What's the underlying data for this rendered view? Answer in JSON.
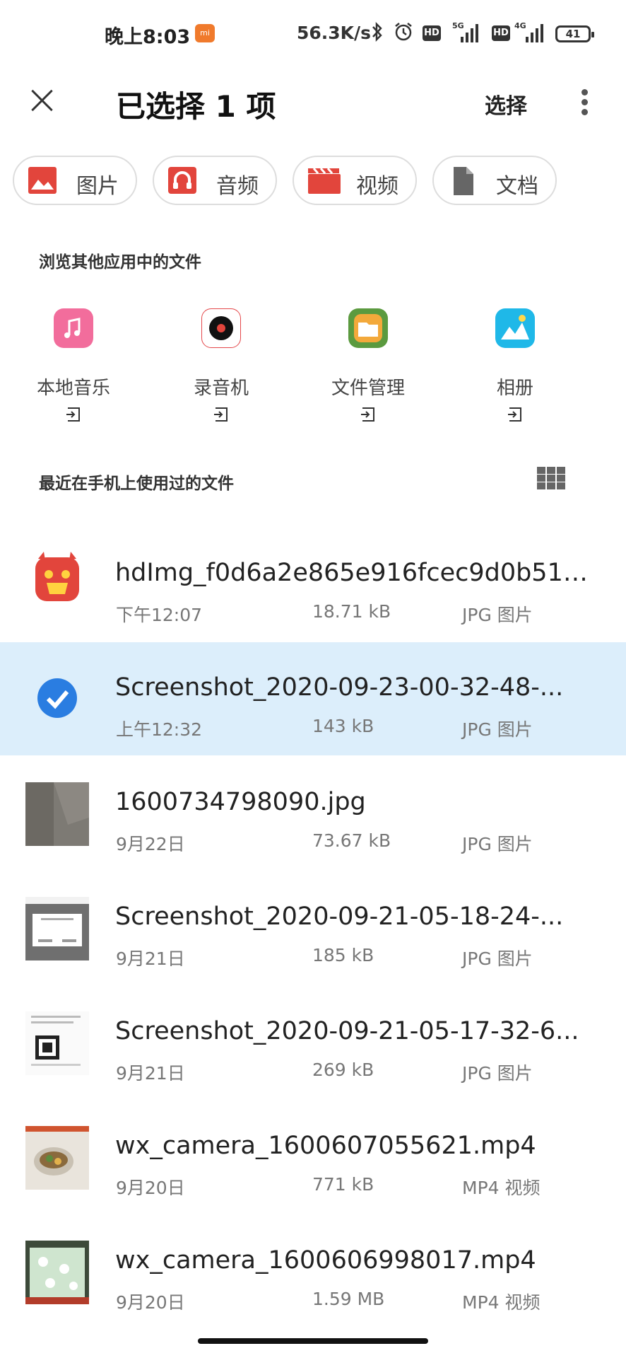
{
  "status_bar": {
    "time": "晚上8:03",
    "mi_badge": "mi",
    "speed": "56.3K/s",
    "signal1_label": "5G",
    "signal2_label": "4G",
    "hd_label": "HD",
    "battery": "41"
  },
  "header": {
    "title": "已选择 1 项",
    "select_label": "选择"
  },
  "categories": [
    {
      "label": "图片",
      "icon": "image-icon",
      "color": "#e2453c"
    },
    {
      "label": "音频",
      "icon": "headphones-icon",
      "color": "#e2453c"
    },
    {
      "label": "视频",
      "icon": "clapperboard-icon",
      "color": "#e2453c"
    },
    {
      "label": "文档",
      "icon": "document-icon",
      "color": "#666666"
    }
  ],
  "browse_section_label": "浏览其他应用中的文件",
  "apps": [
    {
      "label": "本地音乐",
      "icon": "music-app-icon"
    },
    {
      "label": "录音机",
      "icon": "recorder-app-icon"
    },
    {
      "label": "文件管理",
      "icon": "file-manager-app-icon"
    },
    {
      "label": "相册",
      "icon": "gallery-app-icon"
    }
  ],
  "recent_section_label": "最近在手机上使用过的文件",
  "files": [
    {
      "name": "hdImg_f0d6a2e865e916fcec9d0b5110...",
      "date": "下午12:07",
      "size": "18.71 kB",
      "type": "JPG 图片",
      "selected": false
    },
    {
      "name": "Screenshot_2020-09-23-00-32-48-...",
      "date": "上午12:32",
      "size": "143 kB",
      "type": "JPG 图片",
      "selected": true
    },
    {
      "name": "1600734798090.jpg",
      "date": "9月22日",
      "size": "73.67 kB",
      "type": "JPG 图片",
      "selected": false
    },
    {
      "name": "Screenshot_2020-09-21-05-18-24-...",
      "date": "9月21日",
      "size": "185 kB",
      "type": "JPG 图片",
      "selected": false
    },
    {
      "name": "Screenshot_2020-09-21-05-17-32-6...",
      "date": "9月21日",
      "size": "269 kB",
      "type": "JPG 图片",
      "selected": false
    },
    {
      "name": "wx_camera_1600607055621.mp4",
      "date": "9月20日",
      "size": "771 kB",
      "type": "MP4 视频",
      "selected": false
    },
    {
      "name": "wx_camera_1600606998017.mp4",
      "date": "9月20日",
      "size": "1.59 MB",
      "type": "MP4 视频",
      "selected": false
    }
  ],
  "colors": {
    "accent": "#2a7de1",
    "selected_row": "#dceefb",
    "red": "#e2453c"
  }
}
